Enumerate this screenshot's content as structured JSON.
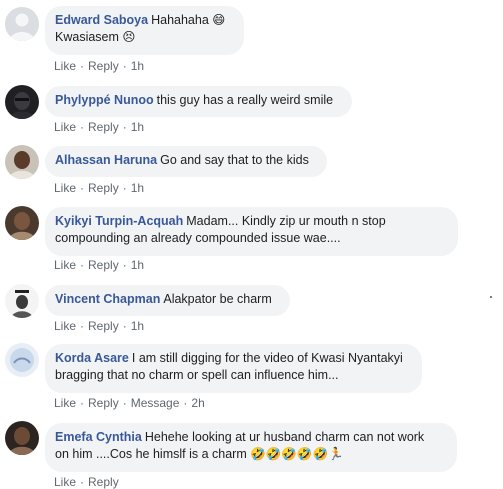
{
  "comments": [
    {
      "author": "Edward Saboya",
      "text": "Hahahaha 😄",
      "text2": "Kwasiasem 😣",
      "actions": {
        "like": "Like",
        "reply": "Reply",
        "time": "1h"
      },
      "avatar": "default-profile-icon"
    },
    {
      "author": "Phylyppé Nunoo",
      "text": "this guy has a really weird smile",
      "actions": {
        "like": "Like",
        "reply": "Reply",
        "time": "1h"
      },
      "avatar": "profile-photo"
    },
    {
      "author": "Alhassan Haruna",
      "text": "Go and say that to the kids",
      "actions": {
        "like": "Like",
        "reply": "Reply",
        "time": "1h"
      },
      "avatar": "profile-photo"
    },
    {
      "author": "Kyikyi Turpin-Acquah",
      "text": "Madam... Kindly zip ur mouth n stop",
      "text2": "compounding an already compounded issue wae....",
      "actions": {
        "like": "Like",
        "reply": "Reply",
        "time": "1h"
      },
      "avatar": "profile-photo"
    },
    {
      "author": "Vincent Chapman",
      "text": "Alakpator be charm",
      "actions": {
        "like": "Like",
        "reply": "Reply",
        "time": "1h"
      },
      "avatar": "profile-photo"
    },
    {
      "author": "Korda Asare",
      "text": "I am still digging for the video of Kwasi Nyantakyi",
      "text2": "bragging that no charm or spell can influence him...",
      "actions": {
        "like": "Like",
        "reply": "Reply",
        "message": "Message",
        "time": "2h"
      },
      "avatar": "profile-photo"
    },
    {
      "author": "Emefa Cynthia",
      "text": "Hehehe looking at ur husband charm can not work",
      "text2": "on him ....Cos he himslf is a charm 🤣🤣🤣🤣🤣🏃",
      "actions": {
        "like": "Like",
        "reply": "Reply"
      },
      "avatar": "profile-photo"
    }
  ],
  "colors": {
    "author": "#385898",
    "bubble": "#f2f3f5",
    "meta": "#606770",
    "text": "#1c1e21"
  }
}
